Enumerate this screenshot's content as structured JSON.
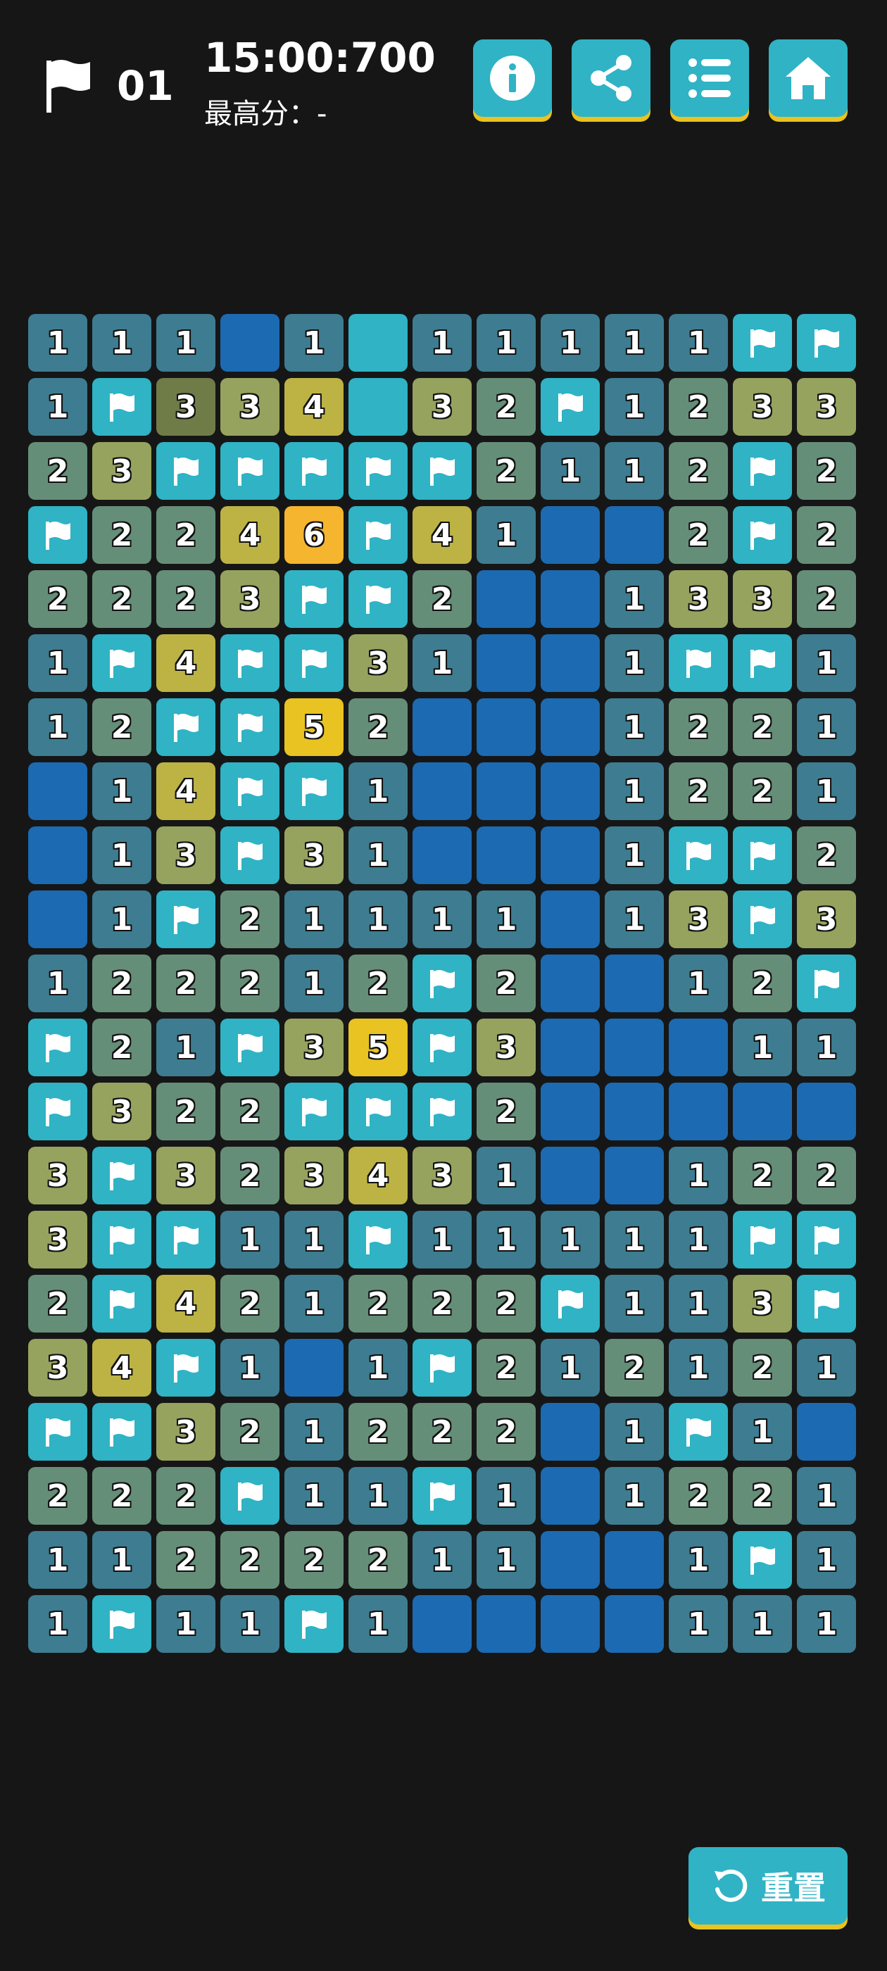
{
  "header": {
    "flag_count": "01",
    "timer": "15:00:700",
    "best_score": "最高分：-",
    "buttons": [
      {
        "name": "info-button",
        "icon": "info-icon"
      },
      {
        "name": "share-button",
        "icon": "share-icon"
      },
      {
        "name": "menu-button",
        "icon": "list-icon"
      },
      {
        "name": "home-button",
        "icon": "home-icon"
      }
    ]
  },
  "colors": {
    "background": "#161616",
    "accent": "#2fb3c5",
    "button_shadow": "#e8c321",
    "covered": "#1c6ab1",
    "flag": "#2fb3c5",
    "n1": "#3e7c91",
    "n2": "#658e79",
    "n3": "#96a35e",
    "n3_dark": "#6f7c48",
    "n4": "#bcb344",
    "n5": "#e8c321",
    "n6": "#f6b52e"
  },
  "board": {
    "rows": 21,
    "cols": 13,
    "cells": [
      [
        "1",
        "1",
        "1",
        "C",
        "1",
        "E",
        "1",
        "1",
        "1",
        "1",
        "1",
        "F",
        "F"
      ],
      [
        "1",
        "F",
        "3d",
        "3",
        "4",
        "E",
        "3",
        "2",
        "F",
        "1",
        "2",
        "3",
        "3"
      ],
      [
        "2",
        "3",
        "F",
        "F",
        "F",
        "F",
        "F",
        "2",
        "1",
        "1",
        "2",
        "F",
        "2"
      ],
      [
        "F",
        "2",
        "2",
        "4",
        "6",
        "F",
        "4",
        "1",
        "C",
        "C",
        "2",
        "F",
        "2"
      ],
      [
        "2",
        "2",
        "2",
        "3",
        "F",
        "F",
        "2",
        "C",
        "C",
        "1",
        "3",
        "3",
        "2"
      ],
      [
        "1",
        "F",
        "4",
        "F",
        "F",
        "3",
        "1",
        "C",
        "C",
        "1",
        "F",
        "F",
        "1"
      ],
      [
        "1",
        "2",
        "F",
        "F",
        "5",
        "2",
        "C",
        "C",
        "C",
        "1",
        "2",
        "2",
        "1"
      ],
      [
        "C",
        "1",
        "4",
        "F",
        "F",
        "1",
        "C",
        "C",
        "C",
        "1",
        "2",
        "2",
        "1"
      ],
      [
        "C",
        "1",
        "3",
        "F",
        "3",
        "1",
        "C",
        "C",
        "C",
        "1",
        "F",
        "F",
        "2"
      ],
      [
        "C",
        "1",
        "F",
        "2",
        "1",
        "1",
        "1",
        "1",
        "C",
        "1",
        "3",
        "F",
        "3"
      ],
      [
        "1",
        "2",
        "2",
        "2",
        "1",
        "2",
        "F",
        "2",
        "C",
        "C",
        "1",
        "2",
        "F"
      ],
      [
        "F",
        "2",
        "1",
        "F",
        "3",
        "5",
        "F",
        "3",
        "C",
        "C",
        "C",
        "1",
        "1"
      ],
      [
        "F",
        "3",
        "2",
        "2",
        "F",
        "F",
        "F",
        "2",
        "C",
        "C",
        "C",
        "C",
        "C"
      ],
      [
        "3",
        "F",
        "3",
        "2",
        "3",
        "4",
        "3",
        "1",
        "C",
        "C",
        "1",
        "2",
        "2"
      ],
      [
        "3",
        "F",
        "F",
        "1",
        "1",
        "F",
        "1",
        "1",
        "1",
        "1",
        "1",
        "F",
        "F"
      ],
      [
        "2",
        "F",
        "4",
        "2",
        "1",
        "2",
        "2",
        "2",
        "F",
        "1",
        "1",
        "3",
        "F"
      ],
      [
        "3",
        "4",
        "F",
        "1",
        "C",
        "1",
        "F",
        "2",
        "1",
        "2",
        "1",
        "2",
        "1"
      ],
      [
        "F",
        "F",
        "3",
        "2",
        "1",
        "2",
        "2",
        "2",
        "C",
        "1",
        "F",
        "1",
        "C"
      ],
      [
        "2",
        "2",
        "2",
        "F",
        "1",
        "1",
        "F",
        "1",
        "C",
        "1",
        "2",
        "2",
        "1"
      ],
      [
        "1",
        "1",
        "2",
        "2",
        "2",
        "2",
        "1",
        "1",
        "C",
        "C",
        "1",
        "F",
        "1"
      ],
      [
        "1",
        "F",
        "1",
        "1",
        "F",
        "1",
        "C",
        "C",
        "C",
        "C",
        "1",
        "1",
        "1"
      ]
    ]
  },
  "reset_label": "重置",
  "icons": {
    "flag": "flag-icon",
    "reset": "reset-icon"
  }
}
